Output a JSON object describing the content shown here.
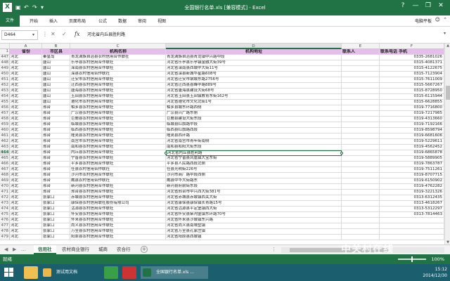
{
  "window": {
    "title": "全国银行名单.xls [兼容模式] - Excel",
    "icon": "excel-logo",
    "controls": [
      "?",
      "—",
      "❐",
      "✕"
    ]
  },
  "ribbon": {
    "tabs": [
      "文件",
      "开始",
      "插入",
      "页面布局",
      "公式",
      "数据",
      "审阅",
      "视图"
    ],
    "user": "电脑平板"
  },
  "formula_bar": {
    "name_box": "D464",
    "formula": "河北省内丘县胜利路"
  },
  "columns": [
    "A",
    "B",
    "C",
    "D",
    "E",
    "F"
  ],
  "selected_column": "D",
  "header_row": {
    "num": "1",
    "cells": [
      "省份",
      "市区县",
      "机构名称",
      "机构地址",
      "联系人",
      "联系电话 手机"
    ]
  },
  "selected_row": "464",
  "rows": [
    {
      "num": "447",
      "a": "河北",
      "b": "秦皇岛",
      "c": "青龙满族自治县农村信用合作联社",
      "d": "青龙满族自治县青龙镇中兴路中段",
      "f": "0335-2681026"
    },
    {
      "num": "448",
      "a": "河北",
      "b": "唐山",
      "c": "乐亭县农村信用合作联社",
      "d": "河北省乐亭县乐亭镇金融大街39号",
      "f": "0315-4081371"
    },
    {
      "num": "449",
      "a": "河北",
      "b": "唐山",
      "c": "滦南县农村信用合作联社",
      "d": "河北省滦南县西城中大街11号",
      "f": "0315-4122675"
    },
    {
      "num": "450",
      "a": "河北",
      "b": "唐山",
      "c": "滦县农村信用合作联社",
      "d": "河北省滦县新城华星路608号",
      "f": "0315-7123904"
    },
    {
      "num": "451",
      "a": "河北",
      "b": "唐山",
      "c": "迁安市农村信用合作联社",
      "d": "河北省迁安市钢城东路2756号",
      "f": "0315-7611009"
    },
    {
      "num": "452",
      "a": "河北",
      "b": "唐山",
      "c": "迁西县农村信用合作联社",
      "d": "河北省迁西县喜峰中路889号",
      "f": "0315-5667267"
    },
    {
      "num": "453",
      "a": "河北",
      "b": "唐山",
      "c": "唐海县农村信用合作联社",
      "d": "河北省唐海县建设大街68号",
      "f": "0315-8728950"
    },
    {
      "num": "454",
      "a": "河北",
      "b": "唐山",
      "c": "玉田县农村信用合作联社",
      "d": "河北省玉田县玉田镇教育东街162号",
      "f": "0315-6115944"
    },
    {
      "num": "455",
      "a": "河北",
      "b": "唐山",
      "c": "遵化市农村信用合作联社",
      "d": "河北省遵化市文化北街1号",
      "f": "0315-6628855"
    },
    {
      "num": "456",
      "a": "河北",
      "b": "邢台",
      "c": "柏乡县农村信用合作联社",
      "d": "柏乡县城东环路西侧",
      "f": "0319-7716800"
    },
    {
      "num": "457",
      "a": "河北",
      "b": "邢台",
      "c": "广宗县农村信用合作联社",
      "d": "广宗县兴广路东侧",
      "f": "0319-7217985"
    },
    {
      "num": "458",
      "a": "河北",
      "b": "邢台",
      "c": "巨鹿县农村信用合作联社",
      "d": "巨鹿县建设大街东段",
      "f": "0319-4313660"
    },
    {
      "num": "459",
      "a": "河北",
      "b": "邢台",
      "c": "临城县农村信用合作联社",
      "d": "临城县红旗路中段",
      "f": "0319-7192166"
    },
    {
      "num": "460",
      "a": "河北",
      "b": "邢台",
      "c": "临西县农村信用合作联社",
      "d": "临西县红旗路西段",
      "f": "0319-8598794"
    },
    {
      "num": "461",
      "a": "河北",
      "b": "邢台",
      "c": "隆尧县农村信用合作联社",
      "d": "隆尧县西环路",
      "f": "0319-6681606"
    },
    {
      "num": "462",
      "a": "河北",
      "b": "邢台",
      "c": "南宫市农村信用合作联社",
      "d": "河北省南宫市青年街南侧",
      "f": "0319-5229611"
    },
    {
      "num": "463",
      "a": "河北",
      "b": "邢台",
      "c": "南和县农村信用合作联社",
      "d": "南和县和阳大街东段",
      "f": "0319-4562452"
    },
    {
      "num": "464",
      "a": "河北",
      "b": "邢台",
      "c": "内丘县农村信用合作联社",
      "d": "河北省内丘县胜利路",
      "f": "0319-6865878"
    },
    {
      "num": "465",
      "a": "河北",
      "b": "邢台",
      "c": "宁晋县农村信用合作联社",
      "d": "河北省宁晋县凤凰镇大宝东街",
      "f": "0319-5889905"
    },
    {
      "num": "466",
      "a": "河北",
      "b": "邢台",
      "c": "平乡县农村信用合作联社",
      "d": "平乡县人民路西段北侧",
      "f": "0319-7863787"
    },
    {
      "num": "467",
      "a": "河北",
      "b": "邢台",
      "c": "任县农村信用合作联社",
      "d": "任县光明街226号",
      "f": "0319-7511261"
    },
    {
      "num": "468",
      "a": "河北",
      "b": "邢台",
      "c": "沙河市农村信用合作联社",
      "d": "沙河市商厂路中段西侧",
      "f": "0319-8707715"
    },
    {
      "num": "469",
      "a": "河北",
      "b": "邢台",
      "c": "威县农村信用合作联社",
      "d": "威县中华大街路东",
      "f": "0319-6150902"
    },
    {
      "num": "470",
      "a": "河北",
      "b": "邢台",
      "c": "新河县农村信用合作联社",
      "d": "新河县府前街东段",
      "f": "0319-4762282"
    },
    {
      "num": "471",
      "a": "河北",
      "b": "邢台",
      "c": "邢台县农村信用合作联社",
      "d": "河北省邢台市中兴西大街381号",
      "f": "0319-3221326"
    },
    {
      "num": "472",
      "a": "河北",
      "b": "张家口",
      "c": "赤城县农村信用合作联社",
      "d": "河北省赤城县赤城镇西关大街",
      "f": "0313-6312435"
    },
    {
      "num": "473",
      "a": "河北",
      "b": "张家口",
      "c": "康保县农村信用联社股份有限公司",
      "d": "河北省康保县康保镇长青路15号",
      "f": "0313-4618267"
    },
    {
      "num": "474",
      "a": "河北",
      "b": "张家口",
      "c": "沽源县农村信用合作联社",
      "d": "河北省沽源县平定堡镇西大街",
      "f": "0313-5312297"
    },
    {
      "num": "475",
      "a": "河北",
      "b": "张家口",
      "c": "怀安县农村信用合作联社",
      "d": "河北省怀安县柴沟堡镇东环路70号",
      "f": "0313-7814463"
    },
    {
      "num": "476",
      "a": "河北",
      "b": "张家口",
      "c": "怀来县农村信用合作联社",
      "d": "河北省怀来县沙城镇东兴路",
      "f": ""
    },
    {
      "num": "477",
      "a": "河北",
      "b": "张家口",
      "c": "尚义县农村信用合作联社",
      "d": "河北省尚义县南壕堑镇",
      "f": ""
    },
    {
      "num": "478",
      "a": "河北",
      "b": "张家口",
      "c": "万全县农村信用合作联社",
      "d": "河北省万全县孔家庄镇",
      "f": ""
    },
    {
      "num": "479",
      "a": "河北",
      "b": "张家口",
      "c": "阳原县农村信用合作联社",
      "d": "河北省阳原县西城镇",
      "f": ""
    }
  ],
  "sheet_tabs": [
    "信用社",
    "农村商业银行",
    "城商",
    "农合行"
  ],
  "active_sheet": "信用社",
  "status": {
    "text": "就绪",
    "zoom": "100%",
    "watermark": "中关村在线"
  },
  "taskbar": {
    "apps": [
      {
        "label": "测试用文档",
        "icon": "folder-icon"
      },
      {
        "label": "全国银行名单.xls ...",
        "icon": "excel-icon"
      }
    ],
    "time": "15:12",
    "date": "2014/12/30"
  },
  "colors": {
    "excel_green": "#217346",
    "header_fill": "#e4bfea",
    "taskbar": "#1b5f6e"
  }
}
